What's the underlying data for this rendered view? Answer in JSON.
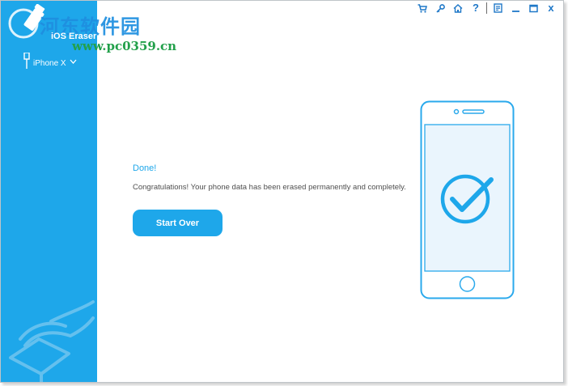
{
  "app": {
    "title": "iOS Eraser",
    "watermark": "河东软件园",
    "watermark_url": "www.pc0359.cn"
  },
  "sidebar": {
    "device_name": "iPhone X",
    "device_icon": "usb-cable-icon",
    "dropdown_icon": "chevron-down-icon"
  },
  "toolbar": {
    "cart_icon": "cart-icon",
    "key_icon": "key-icon",
    "home_icon": "home-icon",
    "help_label": "?",
    "feedback_icon": "feedback-icon",
    "minimize_icon": "minimize-icon",
    "maximize_icon": "maximize-icon",
    "close_label": "x"
  },
  "main": {
    "status_title": "Done!",
    "message": "Congratulations! Your phone data has been erased permanently and completely.",
    "start_over_label": "Start Over"
  },
  "colors": {
    "accent": "#1ea7ea",
    "toolbar_icon": "#1f78c8",
    "message_text": "#4f4f4f",
    "phone_screen": "#eaf5fd"
  }
}
